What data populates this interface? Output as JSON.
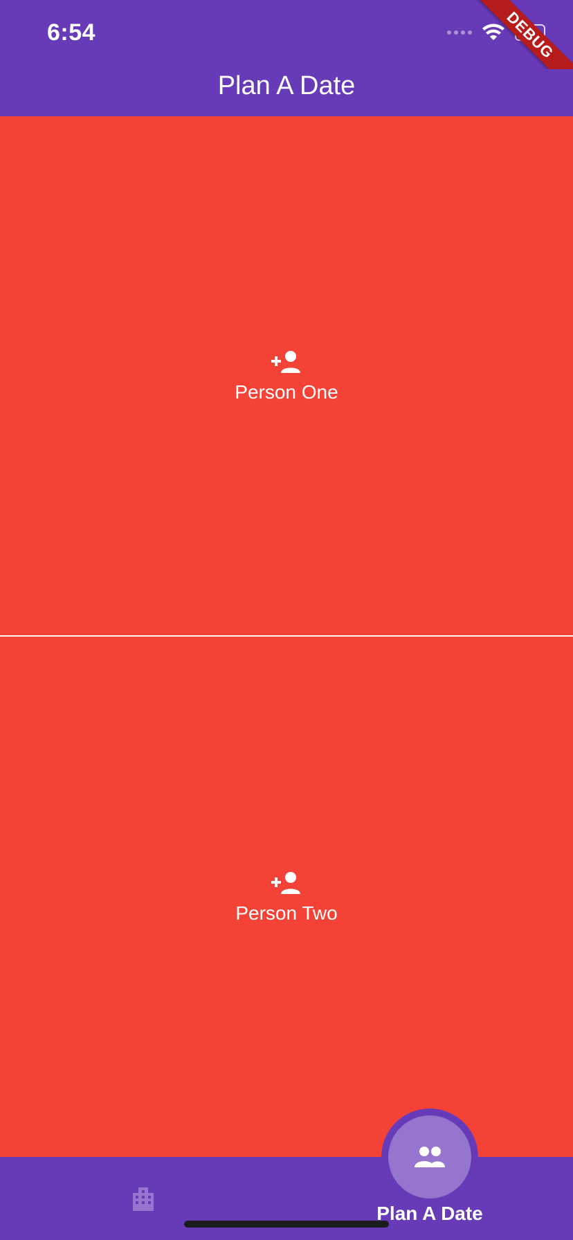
{
  "status_bar": {
    "time": "6:54"
  },
  "app_bar": {
    "title": "Plan A Date"
  },
  "panels": [
    {
      "label": "Person One",
      "icon": "person-add-icon"
    },
    {
      "label": "Person Two",
      "icon": "person-add-icon"
    }
  ],
  "bottom_nav": {
    "left_icon": "apartment-icon",
    "fab_icon": "people-icon",
    "fab_label": "Plan A Date"
  },
  "debug_banner": {
    "text": "DEBUG"
  },
  "colors": {
    "primary": "#673ab7",
    "panel": "#f44336",
    "fab": "#9575cd",
    "nav_icon_inactive": "#9575cd"
  }
}
